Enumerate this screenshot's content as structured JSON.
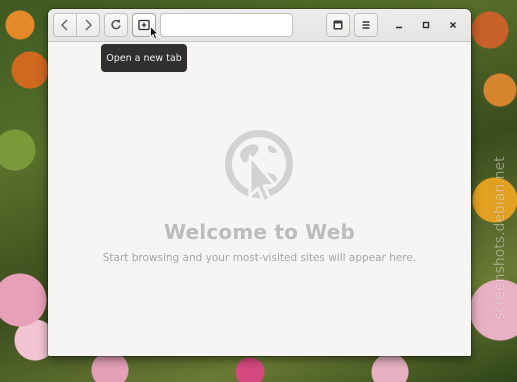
{
  "window": {
    "app_name": "Web"
  },
  "headerbar": {
    "back_icon": "go-previous-icon",
    "forward_icon": "go-next-icon",
    "reload_icon": "reload-icon",
    "new_tab_icon": "new-tab-icon",
    "url_value": "",
    "url_placeholder": "",
    "tabs_icon": "tab-overview-icon",
    "menu_icon": "hamburger-menu-icon",
    "minimize_label": "–",
    "maximize_label": "▫",
    "close_label": "×"
  },
  "tooltip": {
    "text": "Open a new tab"
  },
  "content": {
    "logo_icon": "web-browser-logo-icon",
    "title": "Welcome to Web",
    "subtitle": "Start browsing and your most-visited sites will appear here."
  },
  "watermark": {
    "text": "screenshots.debian.net"
  },
  "colors": {
    "window_bg": "#f6f5f4",
    "headerbar_bg": "#e8e7e5",
    "tooltip_bg": "#1e1e1e",
    "title_color": "#bdbcba",
    "subtitle_color": "#a8a6a3",
    "logo_color": "#d3d2d0"
  }
}
